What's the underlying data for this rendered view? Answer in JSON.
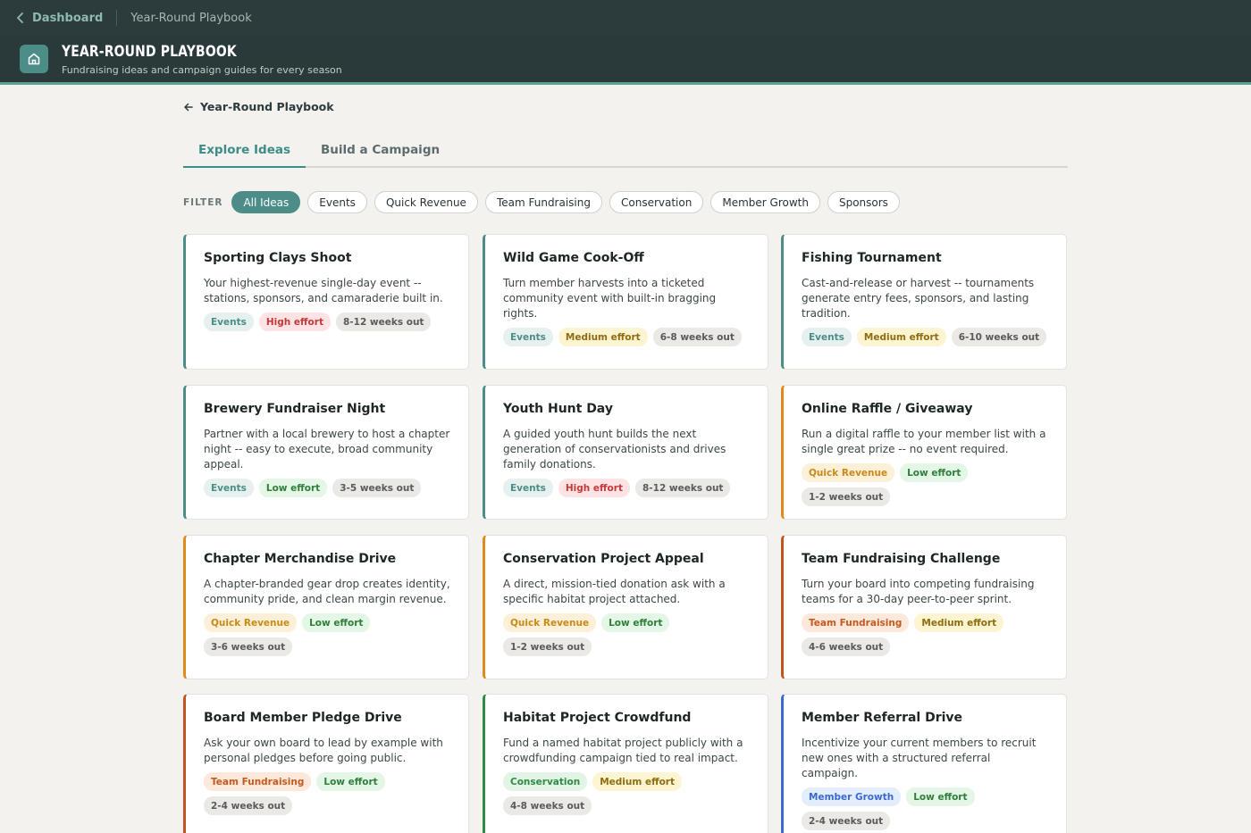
{
  "topbar": {
    "back_label": "Dashboard",
    "current": "Year-Round Playbook"
  },
  "header": {
    "title": "YEAR-ROUND PLAYBOOK",
    "subtitle": "Fundraising ideas and campaign guides for every season"
  },
  "back_link": "Year-Round Playbook",
  "tabs": [
    {
      "label": "Explore Ideas"
    },
    {
      "label": "Build a Campaign"
    }
  ],
  "filters": {
    "label": "FILTER",
    "items": [
      "All Ideas",
      "Events",
      "Quick Revenue",
      "Team Fundraising",
      "Conservation",
      "Member Growth",
      "Sponsors"
    ]
  },
  "colors": {
    "events": "#4c8d87",
    "quick_revenue": "#e08a1a",
    "team_fundraising": "#c4541e",
    "conservation": "#2f8a44",
    "member_growth": "#3a6ad0"
  },
  "cards": [
    {
      "title": "Sporting Clays Shoot",
      "desc": "Your highest-revenue single-day event -- stations, sponsors, and camaraderie built in.",
      "category": "Events",
      "effort": "High effort",
      "timeline": "8-12 weeks out"
    },
    {
      "title": "Wild Game Cook-Off",
      "desc": "Turn member harvests into a ticketed community event with built-in bragging rights.",
      "category": "Events",
      "effort": "Medium effort",
      "timeline": "6-8 weeks out"
    },
    {
      "title": "Fishing Tournament",
      "desc": "Cast-and-release or harvest -- tournaments generate entry fees, sponsors, and lasting tradition.",
      "category": "Events",
      "effort": "Medium effort",
      "timeline": "6-10 weeks out"
    },
    {
      "title": "Brewery Fundraiser Night",
      "desc": "Partner with a local brewery to host a chapter night -- easy to execute, broad community appeal.",
      "category": "Events",
      "effort": "Low effort",
      "timeline": "3-5 weeks out"
    },
    {
      "title": "Youth Hunt Day",
      "desc": "A guided youth hunt builds the next generation of conservationists and drives family donations.",
      "category": "Events",
      "effort": "High effort",
      "timeline": "8-12 weeks out"
    },
    {
      "title": "Online Raffle / Giveaway",
      "desc": "Run a digital raffle to your member list with a single great prize -- no event required.",
      "category": "Quick Revenue",
      "effort": "Low effort",
      "timeline": "1-2 weeks out"
    },
    {
      "title": "Chapter Merchandise Drive",
      "desc": "A chapter-branded gear drop creates identity, community pride, and clean margin revenue.",
      "category": "Quick Revenue",
      "effort": "Low effort",
      "timeline": "3-6 weeks out"
    },
    {
      "title": "Conservation Project Appeal",
      "desc": "A direct, mission-tied donation ask with a specific habitat project attached.",
      "category": "Quick Revenue",
      "effort": "Low effort",
      "timeline": "1-2 weeks out"
    },
    {
      "title": "Team Fundraising Challenge",
      "desc": "Turn your board into competing fundraising teams for a 30-day peer-to-peer sprint.",
      "category": "Team Fundraising",
      "effort": "Medium effort",
      "timeline": "4-6 weeks out"
    },
    {
      "title": "Board Member Pledge Drive",
      "desc": "Ask your own board to lead by example with personal pledges before going public.",
      "category": "Team Fundraising",
      "effort": "Low effort",
      "timeline": "2-4 weeks out"
    },
    {
      "title": "Habitat Project Crowdfund",
      "desc": "Fund a named habitat project publicly with a crowdfunding campaign tied to real impact.",
      "category": "Conservation",
      "effort": "Medium effort",
      "timeline": "4-8 weeks out"
    },
    {
      "title": "Member Referral Drive",
      "desc": "Incentivize your current members to recruit new ones with a structured referral campaign.",
      "category": "Member Growth",
      "effort": "Low effort",
      "timeline": "2-4 weeks out"
    }
  ]
}
